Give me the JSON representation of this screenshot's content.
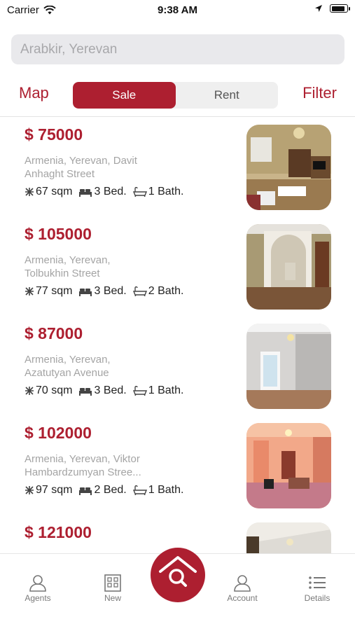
{
  "status": {
    "carrier": "Carrier",
    "time": "9:38 AM"
  },
  "search": {
    "placeholder": "Arabkir, Yerevan"
  },
  "toolbar": {
    "map": "Map",
    "filter": "Filter",
    "segments": [
      "Sale",
      "Rent"
    ],
    "selected": "Sale"
  },
  "listings": [
    {
      "price": "$ 75000",
      "address_line1": "Armenia, Yerevan, Davit",
      "address_line2": "Anhaght Street",
      "area": "67 sqm",
      "beds": "3 Bed.",
      "baths": "1 Bath."
    },
    {
      "price": "$ 105000",
      "address_line1": "Armenia, Yerevan,",
      "address_line2": "Tolbukhin Street",
      "area": "77 sqm",
      "beds": "3 Bed.",
      "baths": "2 Bath."
    },
    {
      "price": "$ 87000",
      "address_line1": "Armenia, Yerevan,",
      "address_line2": "Azatutyan Avenue",
      "area": "70 sqm",
      "beds": "3 Bed.",
      "baths": "1 Bath."
    },
    {
      "price": "$ 102000",
      "address_line1": "Armenia, Yerevan, Viktor",
      "address_line2": "Hambardzumyan Stree...",
      "area": "97 sqm",
      "beds": "2 Bed.",
      "baths": "1 Bath."
    },
    {
      "price": "$ 121000"
    }
  ],
  "tabbar": {
    "agents": "Agents",
    "new": "New",
    "account": "Account",
    "details": "Details"
  },
  "colors": {
    "accent": "#ad1f30"
  }
}
